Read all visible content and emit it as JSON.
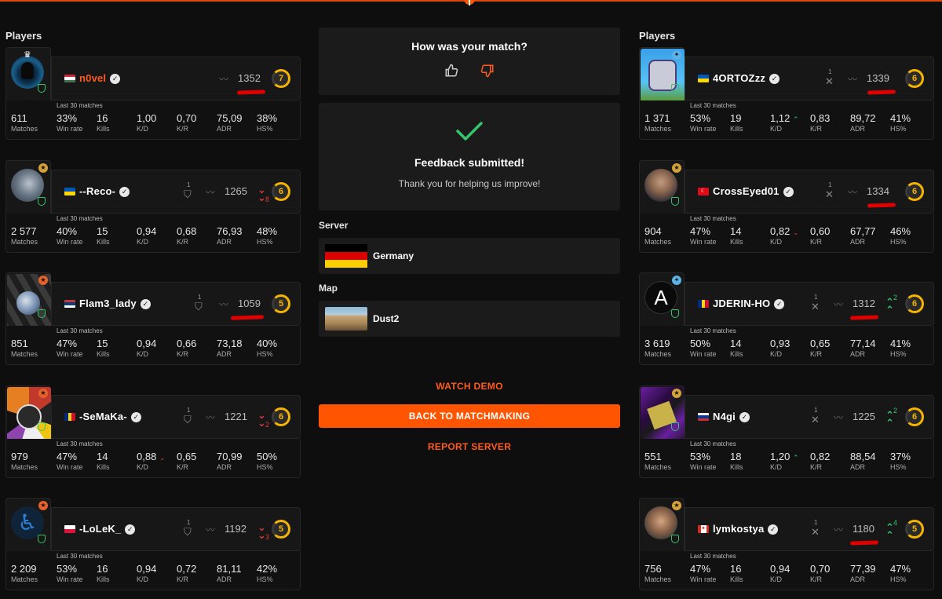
{
  "feedback": {
    "question": "How was your match?",
    "thumb_up_icon": "thumbs-up-icon",
    "thumb_down_icon": "thumbs-down-icon",
    "check_icon": "check-icon",
    "title": "Feedback submitted!",
    "subtitle": "Thank you for helping us improve!"
  },
  "server": {
    "label": "Server",
    "name": "Germany"
  },
  "map": {
    "label": "Map",
    "name": "Dust2"
  },
  "actions": {
    "watch_demo": "WATCH DEMO",
    "back": "BACK TO MATCHMAKING",
    "report": "REPORT SERVER"
  },
  "colors": {
    "accent": "#ff5500",
    "win": "#35c56a",
    "loss": "#e33b3b",
    "level": "#f5b400"
  },
  "stat_labels": {
    "last30": "Last 30 matches",
    "matches": "Matches",
    "winrate": "Win rate",
    "kills": "Kills",
    "kd": "K/D",
    "kr": "K/R",
    "adr": "ADR",
    "hs": "HS%"
  },
  "teams": {
    "left": {
      "label": "Players",
      "players": [
        {
          "name": "n0vel",
          "flag": "Hungary",
          "elo": "1352",
          "level": "7",
          "matches": "611",
          "winrate": "33%",
          "kills": "16",
          "kd": "1,00",
          "kr": "0,70",
          "adr": "75,09",
          "hs": "38%"
        },
        {
          "name": "--Reco-",
          "flag": "Ukraine",
          "party": "1",
          "elo": "1265",
          "delta": "8",
          "level": "6",
          "matches": "2 577",
          "winrate": "40%",
          "kills": "15",
          "kd": "0,94",
          "kr": "0,68",
          "adr": "76,93",
          "hs": "48%"
        },
        {
          "name": "Flam3_lady",
          "flag": "Serbia",
          "party": "1",
          "elo": "1059",
          "level": "5",
          "matches": "851",
          "winrate": "47%",
          "kills": "15",
          "kd": "0,94",
          "kr": "0,66",
          "adr": "73,18",
          "hs": "40%"
        },
        {
          "name": "-SeMaKa-",
          "flag": "Romania",
          "party": "1",
          "elo": "1221",
          "delta": "2",
          "level": "6",
          "matches": "979",
          "winrate": "47%",
          "kills": "14",
          "kd": "0,88",
          "kr": "0,65",
          "adr": "70,99",
          "hs": "50%"
        },
        {
          "name": "-LoLeK_",
          "flag": "Poland",
          "party": "1",
          "elo": "1192",
          "delta": "3",
          "level": "5",
          "matches": "2 209",
          "winrate": "53%",
          "kills": "16",
          "kd": "0,94",
          "kr": "0,72",
          "adr": "81,11",
          "hs": "42%"
        }
      ]
    },
    "right": {
      "label": "Players",
      "players": [
        {
          "name": "4ORTOZzz",
          "flag": "Ukraine",
          "party": "1",
          "elo": "1339",
          "level": "6",
          "matches": "1 371",
          "winrate": "53%",
          "kills": "19",
          "kd": "1,12",
          "kr": "0,83",
          "adr": "89,72",
          "hs": "41%"
        },
        {
          "name": "CrossEyed01",
          "flag": "Turkey",
          "party": "1",
          "elo": "1334",
          "level": "6",
          "matches": "904",
          "winrate": "47%",
          "kills": "14",
          "kd": "0,82",
          "kr": "0,60",
          "adr": "67,77",
          "hs": "46%"
        },
        {
          "name": "JDERIN-HO",
          "flag": "Romania",
          "party": "1",
          "elo": "1312",
          "delta": "2",
          "level": "6",
          "matches": "3 619",
          "winrate": "50%",
          "kills": "14",
          "kd": "0,93",
          "kr": "0,65",
          "adr": "77,14",
          "hs": "41%"
        },
        {
          "name": "N4gi",
          "flag": "Russia",
          "party": "1",
          "elo": "1225",
          "delta": "2",
          "level": "6",
          "matches": "551",
          "winrate": "53%",
          "kills": "18",
          "kd": "1,20",
          "kr": "0,82",
          "adr": "88,54",
          "hs": "37%"
        },
        {
          "name": "lymkostya",
          "flag": "Canada",
          "party": "1",
          "elo": "1180",
          "delta": "4",
          "level": "5",
          "matches": "756",
          "winrate": "47%",
          "kills": "16",
          "kd": "0,94",
          "kr": "0,70",
          "adr": "77,39",
          "hs": "47%"
        }
      ]
    }
  }
}
